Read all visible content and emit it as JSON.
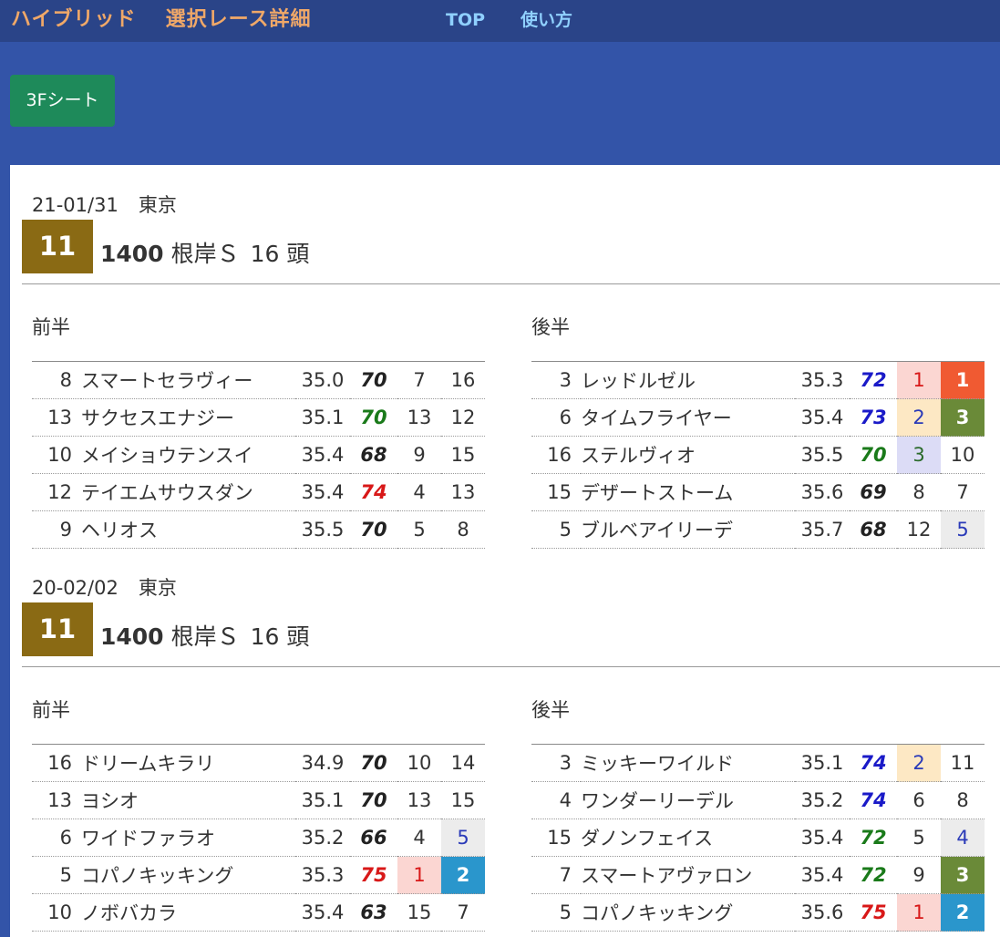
{
  "header": {
    "title_part1": "ハイブリッド",
    "title_part2": "選択レース詳細",
    "nav": {
      "top": "TOP",
      "howto": "使い方"
    }
  },
  "toolbar": {
    "sheet_button": "3Fシート"
  },
  "colors": {
    "header_bg": "#2a4488",
    "page_bg": "#3354a8",
    "brand": "#f0a868",
    "nav_link": "#8fd0ff",
    "button_bg": "#1e8a5a",
    "race_badge": "#8a6a14"
  },
  "races": [
    {
      "date": "21-01/31",
      "venue": "東京",
      "race_no": "11",
      "distance": "1400",
      "name": "根岸Ｓ",
      "count": "16 頭",
      "front_label": "前半",
      "back_label": "後半",
      "front": [
        {
          "num": "8",
          "name": "スマートセラヴィー",
          "time": "35.0",
          "index": "70",
          "idx_color": "black",
          "r1": "7",
          "r1_style": "",
          "r2": "16",
          "r2_style": ""
        },
        {
          "num": "13",
          "name": "サクセスエナジー",
          "time": "35.1",
          "index": "70",
          "idx_color": "green",
          "r1": "13",
          "r1_style": "",
          "r2": "12",
          "r2_style": ""
        },
        {
          "num": "10",
          "name": "メイショウテンスイ",
          "time": "35.4",
          "index": "68",
          "idx_color": "black",
          "r1": "9",
          "r1_style": "",
          "r2": "15",
          "r2_style": ""
        },
        {
          "num": "12",
          "name": "テイエムサウスダン",
          "time": "35.4",
          "index": "74",
          "idx_color": "red",
          "r1": "4",
          "r1_style": "",
          "r2": "13",
          "r2_style": ""
        },
        {
          "num": "9",
          "name": "ヘリオス",
          "time": "35.5",
          "index": "70",
          "idx_color": "black",
          "r1": "5",
          "r1_style": "",
          "r2": "8",
          "r2_style": ""
        }
      ],
      "back": [
        {
          "num": "3",
          "name": "レッドルゼル",
          "time": "35.3",
          "index": "72",
          "idx_color": "blue",
          "r1": "1",
          "r1_style": "pink",
          "r2": "1",
          "r2_style": "orange"
        },
        {
          "num": "6",
          "name": "タイムフライヤー",
          "time": "35.4",
          "index": "73",
          "idx_color": "blue",
          "r1": "2",
          "r1_style": "cream",
          "r2": "3",
          "r2_style": "olive"
        },
        {
          "num": "16",
          "name": "ステルヴィオ",
          "time": "35.5",
          "index": "70",
          "idx_color": "green",
          "r1": "3",
          "r1_style": "lav",
          "r2": "10",
          "r2_style": ""
        },
        {
          "num": "15",
          "name": "デザートストーム",
          "time": "35.6",
          "index": "69",
          "idx_color": "black",
          "r1": "8",
          "r1_style": "",
          "r2": "7",
          "r2_style": ""
        },
        {
          "num": "5",
          "name": "ブルベアイリーデ",
          "time": "35.7",
          "index": "68",
          "idx_color": "black",
          "r1": "12",
          "r1_style": "",
          "r2": "5",
          "r2_style": "grey"
        }
      ]
    },
    {
      "date": "20-02/02",
      "venue": "東京",
      "race_no": "11",
      "distance": "1400",
      "name": "根岸Ｓ",
      "count": "16 頭",
      "front_label": "前半",
      "back_label": "後半",
      "front": [
        {
          "num": "16",
          "name": "ドリームキラリ",
          "time": "34.9",
          "index": "70",
          "idx_color": "black",
          "r1": "10",
          "r1_style": "",
          "r2": "14",
          "r2_style": ""
        },
        {
          "num": "13",
          "name": "ヨシオ",
          "time": "35.1",
          "index": "70",
          "idx_color": "black",
          "r1": "13",
          "r1_style": "",
          "r2": "15",
          "r2_style": ""
        },
        {
          "num": "6",
          "name": "ワイドファラオ",
          "time": "35.2",
          "index": "66",
          "idx_color": "black",
          "r1": "4",
          "r1_style": "",
          "r2": "5",
          "r2_style": "grey"
        },
        {
          "num": "5",
          "name": "コパノキッキング",
          "time": "35.3",
          "index": "75",
          "idx_color": "red",
          "r1": "1",
          "r1_style": "pink",
          "r2": "2",
          "r2_style": "teal"
        },
        {
          "num": "10",
          "name": "ノボバカラ",
          "time": "35.4",
          "index": "63",
          "idx_color": "black",
          "r1": "15",
          "r1_style": "",
          "r2": "7",
          "r2_style": ""
        }
      ],
      "back": [
        {
          "num": "3",
          "name": "ミッキーワイルド",
          "time": "35.1",
          "index": "74",
          "idx_color": "blue",
          "r1": "2",
          "r1_style": "cream",
          "r2": "11",
          "r2_style": ""
        },
        {
          "num": "4",
          "name": "ワンダーリーデル",
          "time": "35.2",
          "index": "74",
          "idx_color": "blue",
          "r1": "6",
          "r1_style": "",
          "r2": "8",
          "r2_style": ""
        },
        {
          "num": "15",
          "name": "ダノンフェイス",
          "time": "35.4",
          "index": "72",
          "idx_color": "green",
          "r1": "5",
          "r1_style": "",
          "r2": "4",
          "r2_style": "grey"
        },
        {
          "num": "7",
          "name": "スマートアヴァロン",
          "time": "35.4",
          "index": "72",
          "idx_color": "green",
          "r1": "9",
          "r1_style": "",
          "r2": "3",
          "r2_style": "olive"
        },
        {
          "num": "5",
          "name": "コパノキッキング",
          "time": "35.6",
          "index": "75",
          "idx_color": "red",
          "r1": "1",
          "r1_style": "pink",
          "r2": "2",
          "r2_style": "teal"
        }
      ]
    }
  ]
}
